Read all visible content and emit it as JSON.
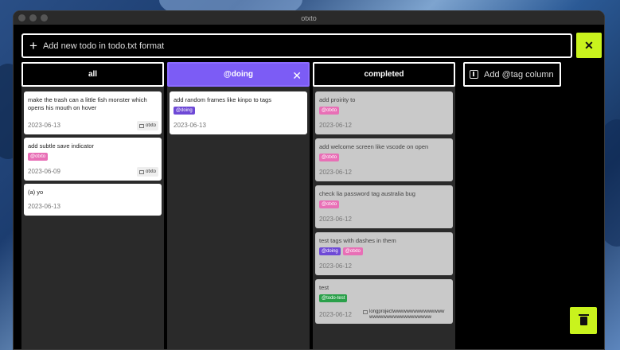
{
  "window": {
    "title": "otxto"
  },
  "add_todo": {
    "placeholder": "Add new todo in todo.txt format",
    "plus_icon": "plus-icon"
  },
  "close_button": {
    "label": "✕"
  },
  "columns": [
    {
      "title": "all",
      "cards": [
        {
          "text": "make the trash can a little fish monster which opens his mouth on hover",
          "date": "2023-06-13",
          "project": "otxto"
        },
        {
          "text": "add subtle save indicator",
          "tags": [
            "@otxto"
          ],
          "date": "2023-06-09",
          "project": "otxto"
        },
        {
          "text": "(a) yo",
          "date": "2023-06-13"
        }
      ]
    },
    {
      "title": "@doing",
      "close": "✕",
      "cards": [
        {
          "text": "add random frames like kinpo to tags",
          "tags": [
            "@doing"
          ],
          "date": "2023-06-13"
        }
      ]
    },
    {
      "title": "completed",
      "cards": [
        {
          "text": "add proirity to",
          "tags": [
            "@otxto"
          ],
          "date": "2023-06-12"
        },
        {
          "text": "add welcome screen like vscode on open",
          "tags": [
            "@otxto"
          ],
          "date": "2023-06-12"
        },
        {
          "text": "check lia password tag australia bug",
          "tags": [
            "@otxto"
          ],
          "date": "2023-06-12"
        },
        {
          "text": "test tags with dashes in them",
          "tags": [
            "@doing",
            "@otxto"
          ],
          "date": "2023-06-12"
        },
        {
          "text": "test",
          "tags": [
            "@todo-test"
          ],
          "date": "2023-06-12",
          "project": "longprojectwwwwwwwwwwwwwwwwwwwwwwwwwwwwwwwww"
        }
      ]
    }
  ],
  "add_tag_column": {
    "label": "Add @tag column"
  },
  "colors": {
    "accent": "#c9f31d",
    "doing": "#7c5cf5",
    "otxto_tag": "#e86fb6",
    "todo_test_tag": "#2aa04a"
  }
}
